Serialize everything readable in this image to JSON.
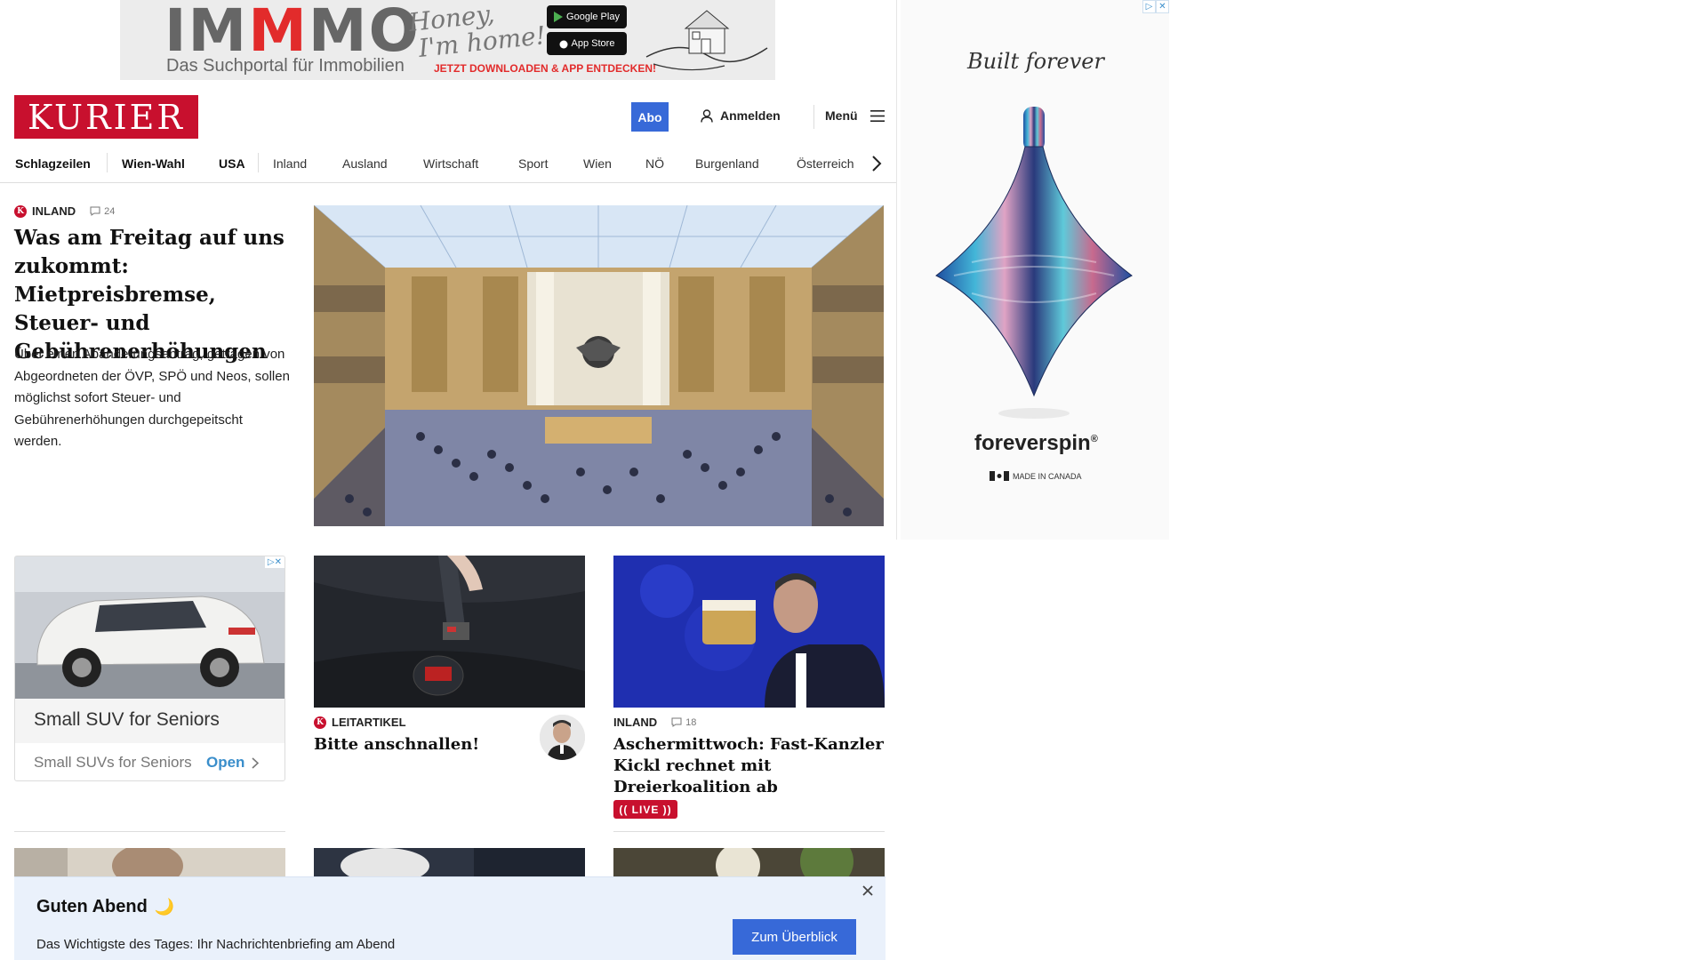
{
  "top_ad": {
    "brand_left": "IM",
    "brand_mid": "M",
    "brand_right": "MO",
    "subtitle": "Das Suchportal für Immobilien",
    "script_line1": "Honey,",
    "script_line2": "I'm home!",
    "google_play": "Google Play",
    "app_store": "App Store",
    "cta": "JETZT DOWNLOADEN & APP ENTDECKEN!"
  },
  "header": {
    "logo": "KURIER",
    "abo_label": "Abo",
    "login_label": "Anmelden",
    "menu_label": "Menü"
  },
  "nav": {
    "items": [
      "Schlagzeilen",
      "Wien-Wahl",
      "USA",
      "Inland",
      "Ausland",
      "Wirtschaft",
      "Sport",
      "Wien",
      "NÖ",
      "Burgenland",
      "Österreich"
    ]
  },
  "lead": {
    "category": "INLAND",
    "comments": "24",
    "title": "Was am Freitag auf uns zukommt: Mietpreisbremse, Steuer- und Gebührenerhöhungen",
    "teaser": "Über einen Abänderungsantrag, getragen von Abgeordneten der ÖVP, SPÖ und Neos, sollen möglichst sofort Steuer- und Gebührenerhöhungen durchgepeitscht werden."
  },
  "sponsored": {
    "title": "Small SUV for Seniors",
    "source": "Small SUVs for Seniors",
    "open_label": "Open"
  },
  "card_leitartikel": {
    "category": "LEITARTIKEL",
    "title": "Bitte anschnallen!"
  },
  "card_inland": {
    "category": "INLAND",
    "comments": "18",
    "title": "Aschermittwoch: Fast-Kanzler Kickl rechnet mit Dreierkoalition ab",
    "live": "LIVE"
  },
  "briefing": {
    "greeting": "Guten Abend",
    "greeting_emoji": "🌙",
    "description": "Das Wichtigste des Tages: Ihr Nachrichtenbriefing am Abend",
    "cta": "Zum Überblick"
  },
  "side_ad": {
    "tagline": "Built forever",
    "brand": "foreverspin",
    "made_in": "MADE IN CANADA"
  },
  "colors": {
    "brand_red": "#c8102e",
    "accent_blue": "#3769d8",
    "briefing_bg": "#eaf1fb"
  },
  "icons": [
    "user-icon",
    "hamburger-icon",
    "chevron-right-icon",
    "comment-icon",
    "close-icon",
    "adchoices-icon"
  ]
}
